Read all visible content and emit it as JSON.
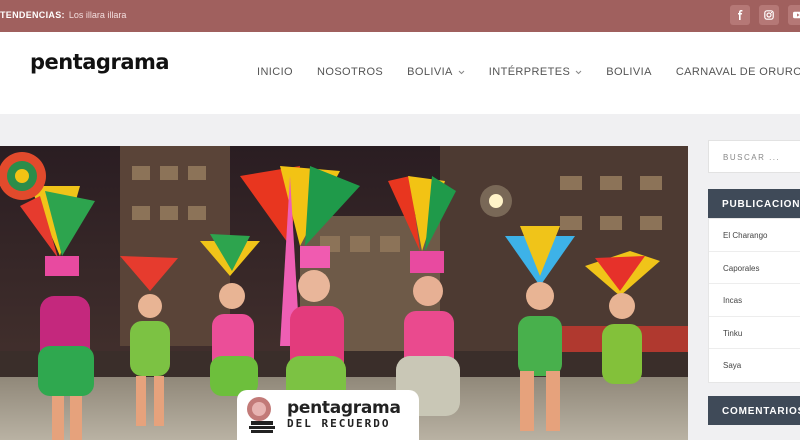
{
  "topbar": {
    "trend_label": "TENDENCIAS:",
    "trend_text": "Los illara illara",
    "social_icons": [
      "facebook-icon",
      "instagram-icon",
      "youtube-icon"
    ]
  },
  "header": {
    "logo": "pentagrama",
    "nav": [
      {
        "label": "INICIO"
      },
      {
        "label": "NOSOTROS"
      },
      {
        "label": "BOLIVIA",
        "dropdown": true
      },
      {
        "label": "INTÉRPRETES",
        "dropdown": true
      },
      {
        "label": "BOLIVIA"
      },
      {
        "label": "CARNAVAL DE ORURO"
      }
    ]
  },
  "hero": {
    "watermark_title": "pentagrama",
    "watermark_subtitle": "DEL RECUERDO"
  },
  "sidebar": {
    "search_placeholder": "BUSCAR ...",
    "publicaciones_title": "PUBLICACIONES",
    "posts": [
      "El Charango",
      "Caporales",
      "Incas",
      "Tinku",
      "Saya"
    ],
    "comentarios_title": "COMENTARIOS"
  },
  "colors": {
    "topbar": "#a0605e",
    "widget_header": "#3f4a58",
    "page_bg": "#f0f0f2"
  }
}
